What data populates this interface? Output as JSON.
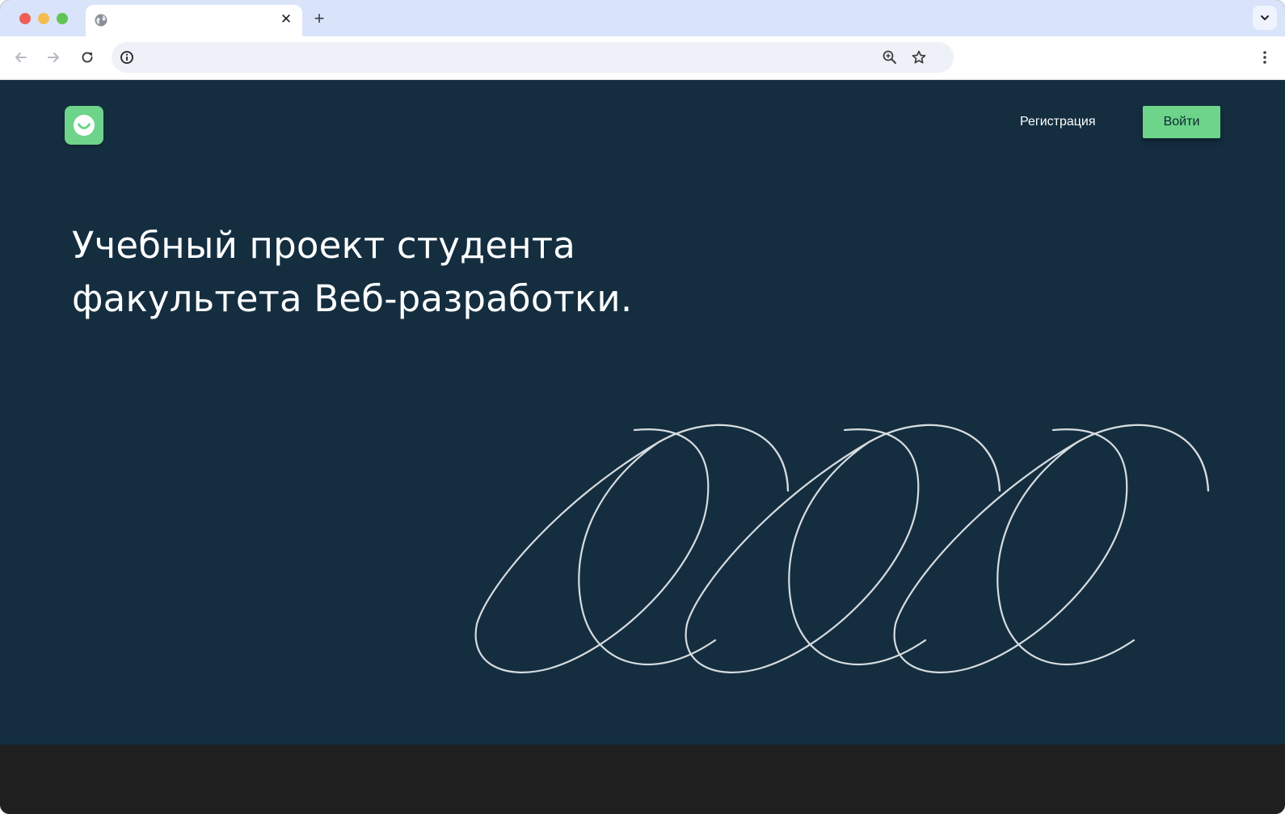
{
  "browser": {
    "tab_close_glyph": "✕",
    "new_tab_glyph": "+",
    "url": "",
    "icons": {
      "tab_favicon": "globe-icon",
      "back": "arrow-left-icon",
      "forward": "arrow-right-icon",
      "reload": "reload-icon",
      "site_info": "info-icon",
      "zoom": "zoom-in-icon",
      "bookmark": "star-icon",
      "menu": "kebab-menu-icon",
      "tab_search": "chevron-down-icon"
    }
  },
  "page": {
    "nav": {
      "register_label": "Регистрация",
      "login_label": "Войти"
    },
    "hero": {
      "title_line1": "Учебный проект студента",
      "title_line2": "факультета Веб-разработки."
    },
    "colors": {
      "background": "#142e40",
      "accent": "#6dd48a",
      "footer": "#1f1f1f"
    }
  }
}
